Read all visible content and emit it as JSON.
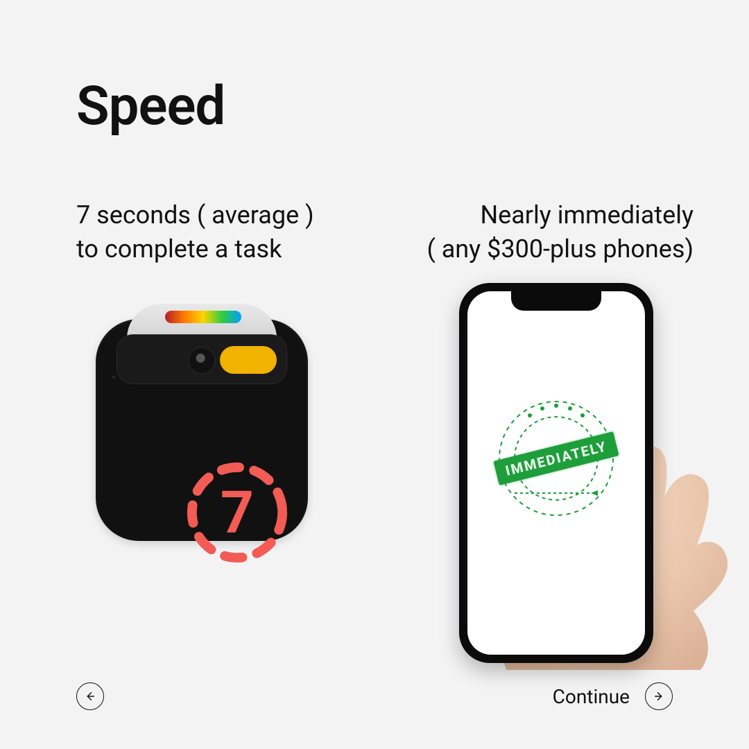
{
  "title": "Speed",
  "left": {
    "caption_line1": "7 seconds ( average )",
    "caption_line2": "to complete a task",
    "badge_value": "7"
  },
  "right": {
    "caption_line1": "Nearly immediately",
    "caption_line2": "( any $300-plus phones)",
    "stamp_label": "IMMEDIATELY"
  },
  "nav": {
    "continue_label": "Continue"
  },
  "colors": {
    "accent_red": "#f25c54",
    "accent_green": "#1e9e3a",
    "badge_yellow": "#f2b200"
  }
}
